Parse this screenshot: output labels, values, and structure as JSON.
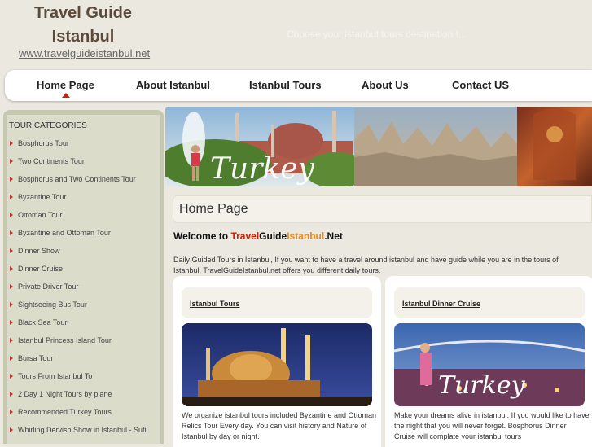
{
  "header": {
    "title": "Travel Guide Istanbul",
    "url": "www.travelguideistanbul.net",
    "tagline": "Choose your istanbul tours destination !..."
  },
  "nav": {
    "items": [
      {
        "label": "Home Page"
      },
      {
        "label": "About Istanbul"
      },
      {
        "label": "Istanbul Tours"
      },
      {
        "label": "About Us"
      },
      {
        "label": "Contact US"
      }
    ]
  },
  "sidebar": {
    "title": "TOUR CATEGORIES",
    "items": [
      {
        "label": "Bosphorus Tour"
      },
      {
        "label": "Two Continents Tour"
      },
      {
        "label": "Bosphorus and Two Continents Tour"
      },
      {
        "label": "Byzantine Tour"
      },
      {
        "label": "Ottoman Tour"
      },
      {
        "label": "Byzantine and Ottoman Tour"
      },
      {
        "label": "Dinner Show"
      },
      {
        "label": "Dinner Cruise"
      },
      {
        "label": "Private Driver Tour"
      },
      {
        "label": "Sightseeing Bus Tour"
      },
      {
        "label": "Black Sea Tour"
      },
      {
        "label": "Istanbul Princess Island Tour"
      },
      {
        "label": "Bursa Tour"
      },
      {
        "label": "Tours From Istanbul To"
      },
      {
        "label": "2 Day 1 Night Tours by plane"
      },
      {
        "label": "Recommended Turkey Tours"
      },
      {
        "label": "Whirling Dervish Show in Istanbul - Sufi"
      }
    ]
  },
  "banner": {
    "text": "Turkey"
  },
  "main": {
    "page_title": "Home Page",
    "welcome_prefix": "Welcome to ",
    "welcome_travel": "Travel",
    "welcome_guide": "Guide",
    "welcome_istanbul": "Istanbul",
    "welcome_suffix": ".Net",
    "intro": "Daily Guided Tours in Istanbul, If you want to have a travel around istanbul and have guide while you are in the tours of Istanbul. TravelGuideIstanbul.net offers you different daily tours.",
    "cards": [
      {
        "title": "Istanbul Tours",
        "text": "We organize istanbul tours included Byzantine and Ottoman Relics Tour Every day. You can visit history and Nature of Istanbul by day or night."
      },
      {
        "title": "Istanbul Dinner Cruise",
        "text": "Make your dreams alive in istanbul. If you would like to have the night that you will never forget. Bosphorus Dinner Cruise will complate your istanbul tours",
        "overlay": "Turkey"
      }
    ]
  },
  "colors": {
    "background": "#ebe8e0",
    "accent_red": "#cc2200",
    "accent_orange": "#e08a2a",
    "sidebar_frame": "#c5c9b0",
    "sidebar_bg": "#dcdcca"
  }
}
